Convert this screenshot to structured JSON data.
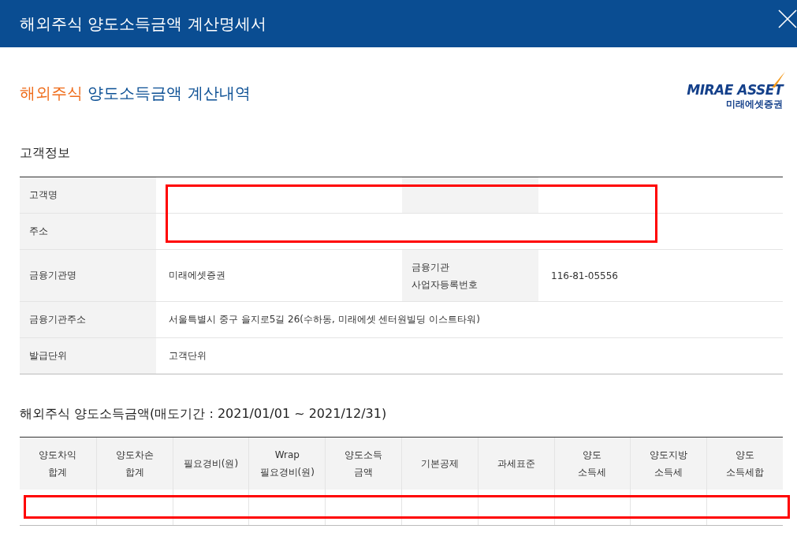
{
  "window": {
    "title": "해외주식 양도소득금액 계산명세서"
  },
  "heading": {
    "accent": "해외주식",
    "rest": "양도소득금액 계산내역"
  },
  "logo": {
    "name": "MIRAE ASSET",
    "sub": "미래에셋증권"
  },
  "customer_info": {
    "title": "고객정보",
    "rows": [
      {
        "kind": "split",
        "label": "고객명"
      },
      {
        "kind": "wide",
        "label": "주소"
      },
      {
        "kind": "split",
        "label": "금융기관명",
        "value": "미래에셋증권",
        "label_2": "금융기관\n사업자등록번호",
        "value_2": "116-81-05556"
      },
      {
        "kind": "wide",
        "label": "금융기관주소",
        "value": "서울특별시 중구 을지로5길 26(수하동, 미래에셋 센터원빌딩 이스트타워)"
      },
      {
        "kind": "wide",
        "label": "발급단위",
        "value": "고객단위"
      }
    ]
  },
  "gains": {
    "title": "해외주식 양도소득금액(매도기간 : 2021/01/01 ~ 2021/12/31)",
    "columns": [
      "양도차익\n합계",
      "양도차손\n합계",
      "필요경비(원)",
      "Wrap\n필요경비(원)",
      "양도소득\n금액",
      "기본공제",
      "과세표준",
      "양도\n소득세",
      "양도지방\n소득세",
      "양도\n소득세합"
    ]
  }
}
